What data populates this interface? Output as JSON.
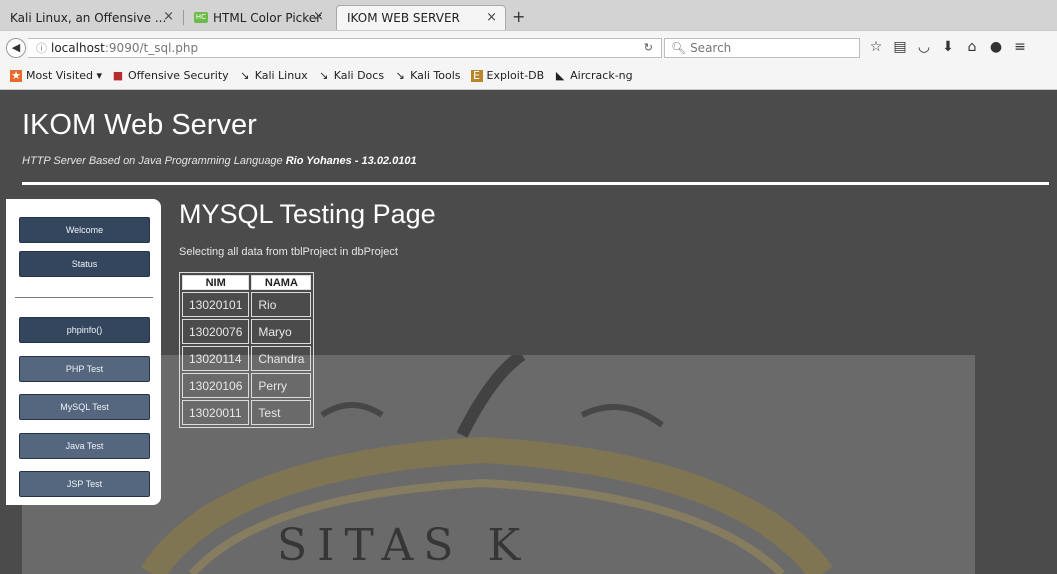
{
  "browser": {
    "tabs": [
      {
        "title": "Kali Linux, an Offensive ...",
        "active": false
      },
      {
        "title": "HTML Color Picker",
        "active": false,
        "favicon": "HC"
      },
      {
        "title": "IKOM WEB SERVER",
        "active": true
      }
    ],
    "new_tab": "+",
    "close_glyph": "×",
    "url_host": "localhost",
    "url_rest": ":9090/t_sql.php",
    "search_placeholder": "Search",
    "bookmarks": [
      {
        "label": "Most Visited ▾",
        "icon": "most-visited-icon"
      },
      {
        "label": "Offensive Security",
        "icon": "offensive-security-icon"
      },
      {
        "label": "Kali Linux",
        "icon": "kali-icon"
      },
      {
        "label": "Kali Docs",
        "icon": "kali-icon"
      },
      {
        "label": "Kali Tools",
        "icon": "kali-icon"
      },
      {
        "label": "Exploit-DB",
        "icon": "exploit-db-icon"
      },
      {
        "label": "Aircrack-ng",
        "icon": "aircrack-icon"
      }
    ]
  },
  "header": {
    "title": "IKOM Web Server",
    "subtitle": "HTTP Server Based on Java Programming Language",
    "author": "Rio Yohanes - 13.02.0101"
  },
  "sidebar": {
    "items": [
      {
        "label": "Welcome"
      },
      {
        "label": "Status"
      },
      {
        "label": "phpinfo()"
      },
      {
        "label": "PHP Test"
      },
      {
        "label": "MySQL Test"
      },
      {
        "label": "Java Test"
      },
      {
        "label": "JSP Test"
      }
    ]
  },
  "main": {
    "title": "MYSQL Testing Page",
    "description": "Selecting all data from tblProject in dbProject",
    "table": {
      "headers": [
        "NIM",
        "NAMA"
      ],
      "rows": [
        [
          "13020101",
          "Rio"
        ],
        [
          "13020076",
          "Maryo"
        ],
        [
          "13020114",
          "Chandra"
        ],
        [
          "13020106",
          "Perry"
        ],
        [
          "13020011",
          "Test"
        ]
      ]
    }
  },
  "watermark_text": "SITAS K"
}
